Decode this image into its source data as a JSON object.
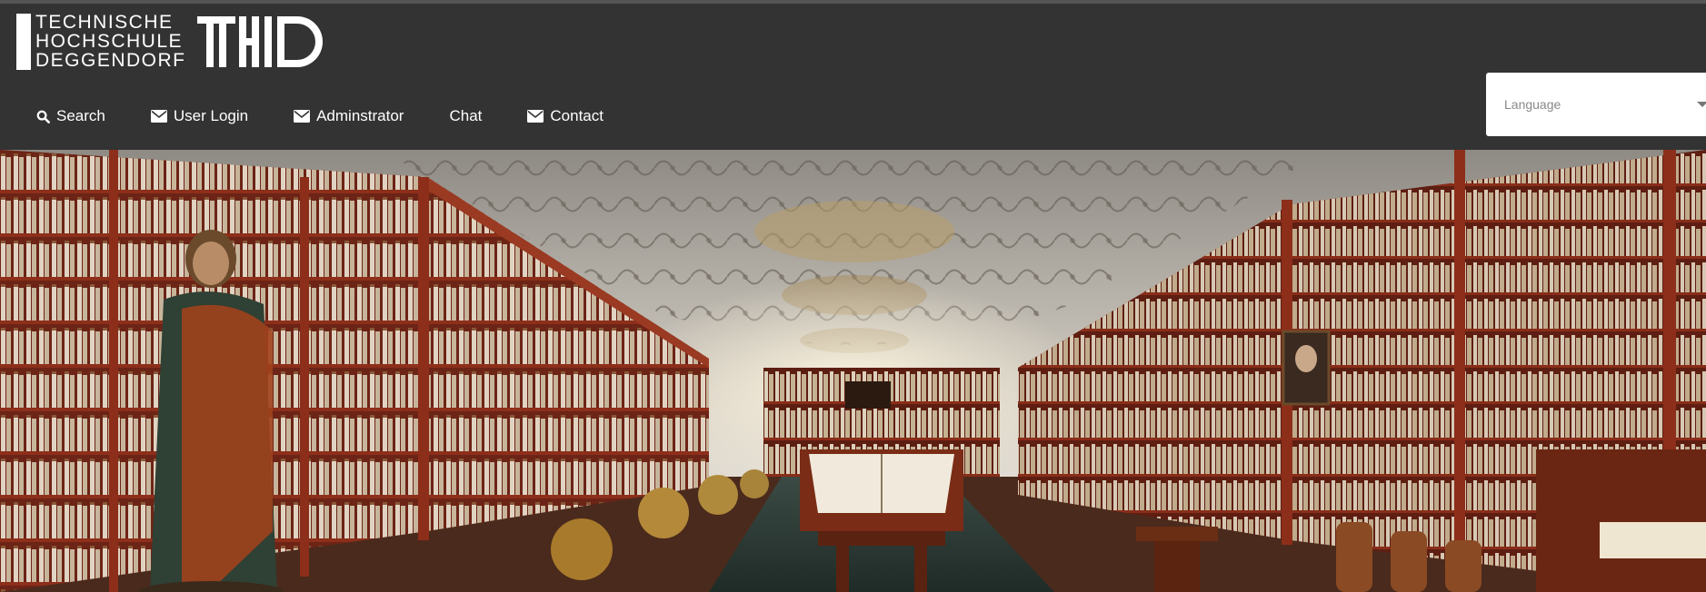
{
  "logo": {
    "lines": [
      "TECHNISCHE",
      "HOCHSCHULE",
      "DEGGENDORF"
    ],
    "mark": "THD"
  },
  "nav": {
    "items": [
      {
        "label": "Search",
        "icon": "search-icon"
      },
      {
        "label": "User Login",
        "icon": "envelope-icon"
      },
      {
        "label": "Adminstrator",
        "icon": "envelope-icon"
      },
      {
        "label": "Chat",
        "icon": ""
      },
      {
        "label": "Contact",
        "icon": "envelope-icon"
      }
    ]
  },
  "language": {
    "label": "Language"
  },
  "colors": {
    "header_bg": "#333333",
    "nav_text": "#ffffff",
    "shelf_wood": "#7a2a18",
    "ceiling": "#cfc9c0"
  }
}
